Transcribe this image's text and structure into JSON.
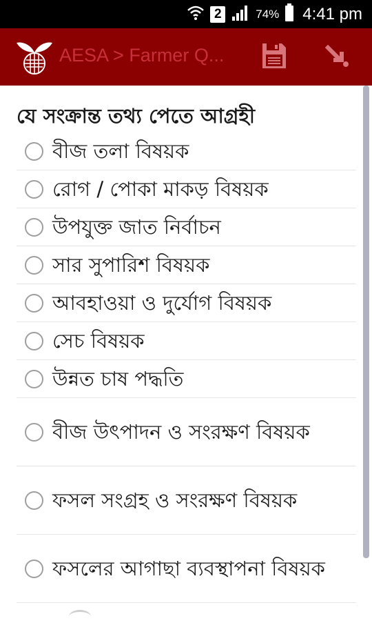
{
  "status_bar": {
    "sim": "2",
    "battery": "74%",
    "time": "4:41 pm"
  },
  "app_bar": {
    "title": "AESA > Farmer Q..."
  },
  "form": {
    "question": "যে সংক্রান্ত তথ্য পেতে আগ্রহী",
    "options": [
      {
        "label": "বীজ তলা বিষয়ক"
      },
      {
        "label": "রোগ / পোকা মাকড় বিষয়ক"
      },
      {
        "label": "উপযুক্ত জাত নির্বাচন"
      },
      {
        "label": "সার সুপারিশ বিষয়ক"
      },
      {
        "label": "আবহাওয়া ও দুর্যোগ বিষয়ক"
      },
      {
        "label": "সেচ বিষয়ক"
      },
      {
        "label": "উন্নত চাষ পদ্ধতি"
      },
      {
        "label": "বীজ উৎপাদন ও সংরক্ষণ বিষয়ক"
      },
      {
        "label": "ফসল সংগ্রহ ও সংরক্ষণ বিষয়ক"
      },
      {
        "label": "ফসলের আগাছা ব্যবস্থাপনা বিষয়ক"
      }
    ]
  },
  "icons": {
    "wifi": "wifi-icon",
    "signal": "signal-icon",
    "battery": "battery-icon",
    "app_logo": "app-logo-icon",
    "save": "save-icon",
    "exit": "exit-arrow-icon"
  },
  "colors": {
    "app_bar": "#8b0000",
    "title_text": "#c7303a",
    "status_bar": "#000000"
  }
}
